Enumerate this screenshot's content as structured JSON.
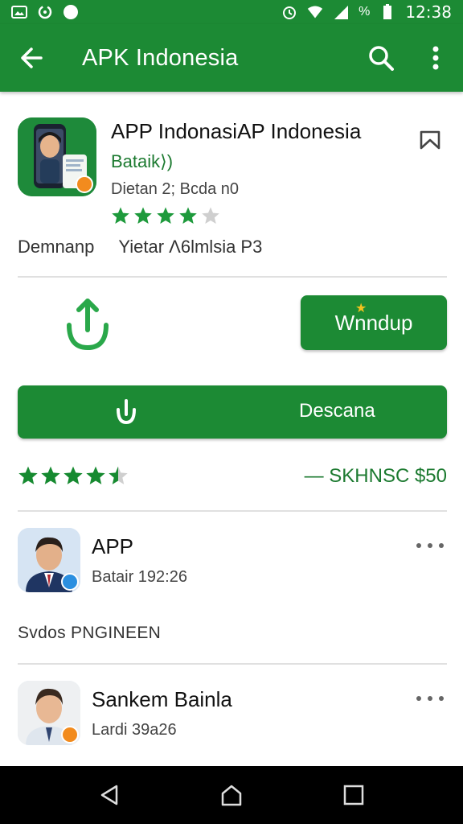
{
  "status_bar": {
    "time": "12:38",
    "battery_symbol": "%",
    "icons": [
      "picture-icon",
      "sync-icon",
      "compass-icon",
      "alarm-icon",
      "wifi-icon",
      "signal-icon",
      "battery-icon"
    ]
  },
  "app_bar": {
    "title": "APK Indonesia",
    "back_icon": "back-arrow-icon",
    "search_icon": "search-icon",
    "menu_icon": "more-vert-icon"
  },
  "app": {
    "name": "APP IndonasiAP Indonesia",
    "developer": "Bataik⟩)",
    "meta": "Dietan 2; Bcda n0",
    "rating_stars": 4,
    "bookmark_icon": "bookmark-icon"
  },
  "sub_row": {
    "left": "Demnanp",
    "right": "Yietar Λ6lmlsia P3"
  },
  "actions": {
    "share_icon": "share-upload-icon",
    "install_label": "Wnndup",
    "download_label": "Descana",
    "download_icon": "download-icon"
  },
  "rating": {
    "stars": 5,
    "filled": 4.5,
    "text": "— SKHNSC $50"
  },
  "list": {
    "items": [
      {
        "title": "APP",
        "subtitle": "Batair 192:26"
      },
      {
        "title": "Sankem Bainla",
        "subtitle": "Lardi 39a26"
      }
    ],
    "section_label": "Svdos PNGINEEN"
  },
  "nav": {
    "back_icon": "nav-back-icon",
    "home_icon": "nav-home-icon",
    "recents_icon": "nav-recents-icon"
  },
  "colors": {
    "primary": "#1c8a34",
    "accent_star": "#1e9a3c",
    "star_empty": "#cfcfcf",
    "badge_orange": "#f28b1e",
    "badge_blue": "#2b8fe0"
  }
}
